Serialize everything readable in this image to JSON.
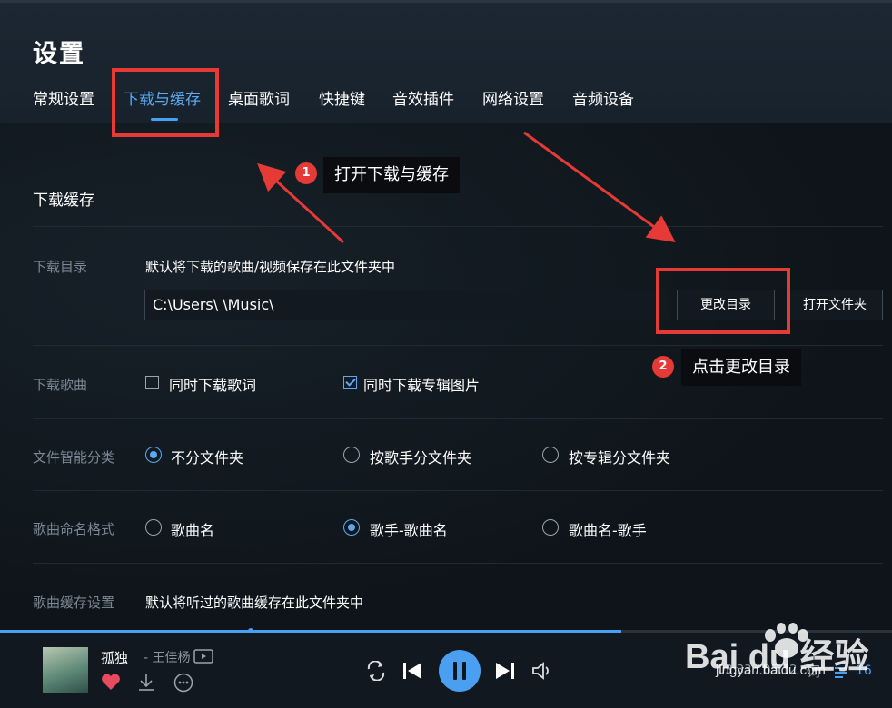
{
  "page": {
    "title": "设置"
  },
  "tabs": [
    {
      "label": "常规设置",
      "active": false
    },
    {
      "label": "下载与缓存",
      "active": true
    },
    {
      "label": "桌面歌词",
      "active": false
    },
    {
      "label": "快捷键",
      "active": false
    },
    {
      "label": "音效插件",
      "active": false
    },
    {
      "label": "网络设置",
      "active": false
    },
    {
      "label": "音频设备",
      "active": false
    }
  ],
  "section": {
    "title": "下载缓存"
  },
  "download_dir": {
    "label": "下载目录",
    "description": "默认将下载的歌曲/视频保存在此文件夹中",
    "path": "C:\\Users\\        \\Music\\",
    "change_button": "更改目录",
    "open_button": "打开文件夹"
  },
  "download_songs": {
    "label": "下载歌曲",
    "options": [
      {
        "label": "同时下载歌词",
        "checked": false
      },
      {
        "label": "同时下载专辑图片",
        "checked": true
      }
    ]
  },
  "smart_classify": {
    "label": "文件智能分类",
    "options": [
      {
        "label": "不分文件夹",
        "selected": true
      },
      {
        "label": "按歌手分文件夹",
        "selected": false
      },
      {
        "label": "按专辑分文件夹",
        "selected": false
      }
    ]
  },
  "naming_format": {
    "label": "歌曲命名格式",
    "options": [
      {
        "label": "歌曲名",
        "selected": false
      },
      {
        "label": "歌手-歌曲名",
        "selected": true
      },
      {
        "label": "歌曲名-歌手",
        "selected": false
      }
    ]
  },
  "cache": {
    "label": "歌曲缓存设置",
    "description": "默认将听过的歌曲缓存在此文件夹中"
  },
  "annotations": [
    {
      "number": "1",
      "text": "打开下载与缓存"
    },
    {
      "number": "2",
      "text": "点击更改目录"
    }
  ],
  "player": {
    "song": "孤独",
    "artist": "- 王佳杨",
    "time": "03:33 / 05:12",
    "lyric_label": "词",
    "queue_count": "16",
    "progress": 0.697
  },
  "watermark": {
    "text": "Bai du 经验",
    "url": "jingyan.baidu.com"
  },
  "colors": {
    "accent": "#4a9ff0",
    "annotation": "#e53a35",
    "background": "#0f151c"
  },
  "icons": [
    "repeat-icon",
    "previous-icon",
    "pause-icon",
    "next-icon",
    "volume-icon",
    "heart-icon",
    "download-icon",
    "more-icon",
    "mv-icon",
    "playlist-icon"
  ]
}
